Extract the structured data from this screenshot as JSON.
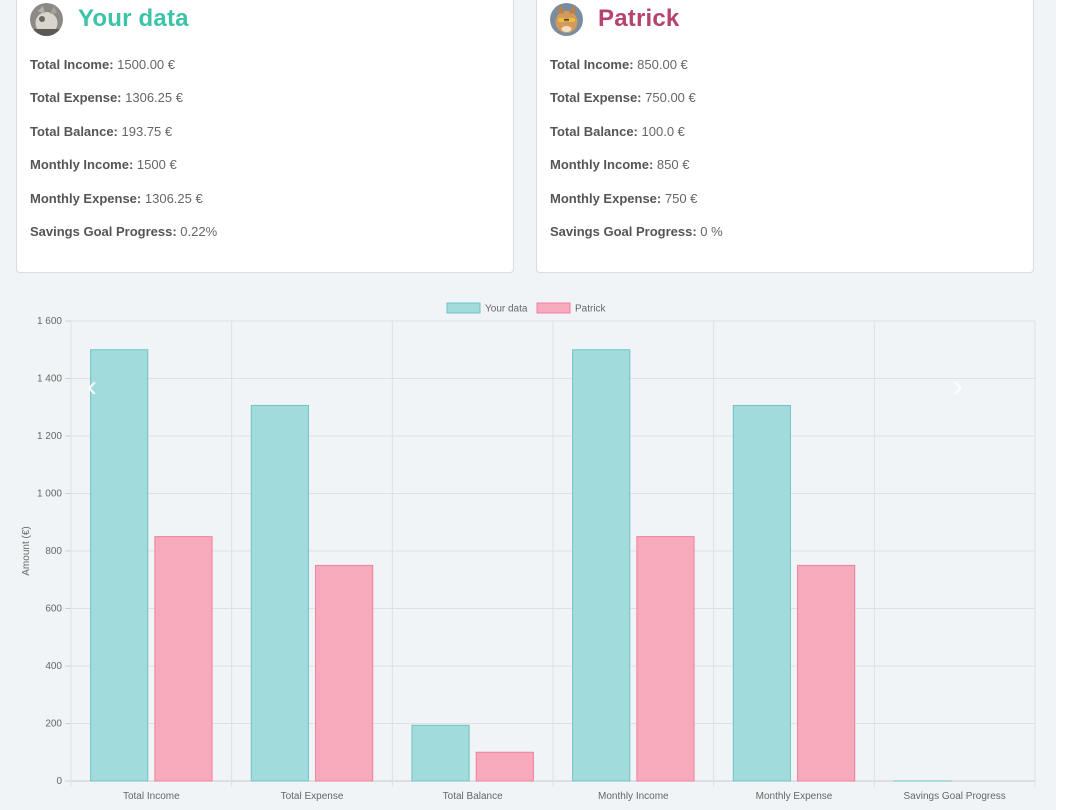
{
  "cards": [
    {
      "title": "Your data",
      "stats": [
        {
          "label": "Total Income:",
          "value": "1500.00 €"
        },
        {
          "label": "Total Expense:",
          "value": "1306.25 €"
        },
        {
          "label": "Total Balance:",
          "value": "193.75 €"
        },
        {
          "label": "Monthly Income:",
          "value": "1500 €"
        },
        {
          "label": "Monthly Expense:",
          "value": "1306.25 €"
        },
        {
          "label": "Savings Goal Progress:",
          "value": "0.22%"
        }
      ]
    },
    {
      "title": "Patrick",
      "stats": [
        {
          "label": "Total Income:",
          "value": "850.00 €"
        },
        {
          "label": "Total Expense:",
          "value": "750.00 €"
        },
        {
          "label": "Total Balance:",
          "value": "100.0 €"
        },
        {
          "label": "Monthly Income:",
          "value": "850 €"
        },
        {
          "label": "Monthly Expense:",
          "value": "750 €"
        },
        {
          "label": "Savings Goal Progress:",
          "value": "0 %"
        }
      ]
    }
  ],
  "carousel": {
    "prev_icon": "chevron-left-icon",
    "next_icon": "chevron-right-icon"
  },
  "colors": {
    "your_data_title": "#3cc3a8",
    "patrick_title": "#b5426f",
    "series_1_fill": "#a2dbdc",
    "series_1_stroke": "#6fc4c4",
    "series_2_fill": "#f8aabd",
    "series_2_stroke": "#ef7f9d"
  },
  "chart_data": {
    "type": "bar",
    "categories": [
      "Total Income",
      "Total Expense",
      "Total Balance",
      "Monthly Income",
      "Monthly Expense",
      "Savings Goal Progress"
    ],
    "series": [
      {
        "name": "Your data",
        "values": [
          1500,
          1306.25,
          193.75,
          1500,
          1306.25,
          0.22
        ]
      },
      {
        "name": "Patrick",
        "values": [
          850,
          750,
          100,
          850,
          750,
          0
        ]
      }
    ],
    "ylabel": "Amount (€)",
    "xlabel": "",
    "ylim": [
      0,
      1600
    ],
    "yticks": [
      "0",
      "200",
      "400",
      "600",
      "800",
      "1 000",
      "1 200",
      "1 400",
      "1 600"
    ],
    "grid": true,
    "legend": "top-center"
  }
}
